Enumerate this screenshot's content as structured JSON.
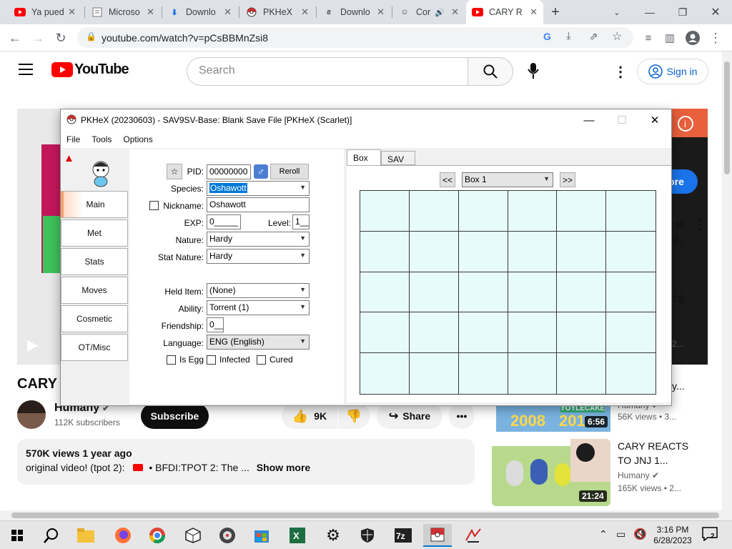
{
  "browser": {
    "tabs": [
      {
        "label": "Ya pued",
        "icon": "youtube-icon"
      },
      {
        "label": "Microso",
        "icon": "document-icon"
      },
      {
        "label": "Downlo",
        "icon": "download-icon"
      },
      {
        "label": "PKHeX",
        "icon": "pokeball-icon"
      },
      {
        "label": "Downlo",
        "icon": "download-icon"
      },
      {
        "label": "Cor",
        "icon": "site-icon"
      },
      {
        "label": "CARY R",
        "icon": "youtube-icon",
        "active": true
      }
    ],
    "url": "youtube.com/watch?v=pCsBBMnZsi8"
  },
  "youtube": {
    "logo": "YouTube",
    "search_placeholder": "Search",
    "signin": "Sign in",
    "video_title": "CARY R",
    "channel": "Humany",
    "subscribers": "112K subscribers",
    "subscribe": "Subscribe",
    "likes": "9K",
    "share": "Share",
    "views_date": "570K views  1 year ago",
    "description": "original video! (tpot 2):",
    "desc_link": "• BFDI:TPOT 2: The ...",
    "show_more": "Show more",
    "overlay_more": "ore",
    "side": [
      {
        "title_line1": "t to",
        "title_line2": "st..."
      },
      {
        "fragment": "TS"
      },
      {
        "fragment": "2..."
      },
      {
        "fragment": "y..."
      }
    ],
    "related": [
      {
        "channel": "Humany",
        "meta": "56K views • 3...",
        "duration": "6:56",
        "thumb_text1": "2008",
        "thumb_text2": "201",
        "thumb_text3": "YOYLECAKE"
      },
      {
        "title1": "CARY REACTS",
        "title2": "TO JNJ 1...",
        "channel": "Humany",
        "meta": "165K views • 2...",
        "duration": "21:24"
      }
    ]
  },
  "pkhex": {
    "title": "PKHeX (20230603) - SAV9SV-Base: Blank Save File [PKHeX (Scarlet)]",
    "menu": [
      "File",
      "Tools",
      "Options"
    ],
    "tabs": [
      "Main",
      "Met",
      "Stats",
      "Moves",
      "Cosmetic",
      "OT/Misc"
    ],
    "labels": {
      "pid": "PID:",
      "species": "Species:",
      "nickname": "Nickname:",
      "exp": "EXP:",
      "level": "Level:",
      "nature": "Nature:",
      "stat_nature": "Stat Nature:",
      "held_item": "Held Item:",
      "ability": "Ability:",
      "friendship": "Friendship:",
      "language": "Language:",
      "is_egg": "Is Egg",
      "infected": "Infected",
      "cured": "Cured"
    },
    "values": {
      "pid": "00000000",
      "reroll": "Reroll",
      "species": "Oshawott",
      "nickname": "Oshawott",
      "exp": "0_____",
      "level": "1__",
      "nature": "Hardy",
      "stat_nature": "Hardy",
      "held_item": "(None)",
      "ability": "Torrent (1)",
      "friendship": "0__",
      "language": "ENG (English)"
    },
    "box_tabs": [
      "Box",
      "SAV"
    ],
    "box_prev": "<<",
    "box_name": "Box 1",
    "box_next": ">>"
  },
  "taskbar": {
    "time": "3:16 PM",
    "date": "6/28/2023",
    "notifications": "2"
  }
}
